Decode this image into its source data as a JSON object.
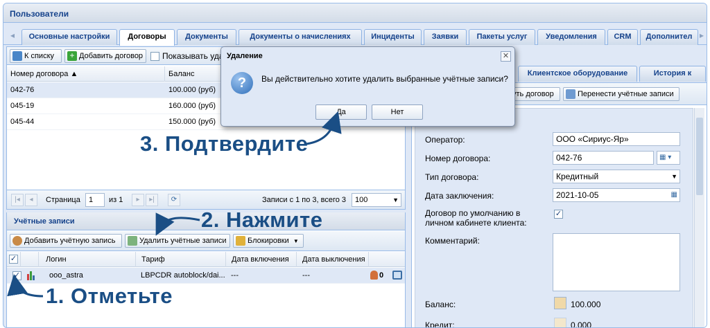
{
  "window": {
    "title": "Пользователи"
  },
  "tabs": [
    {
      "label": "Основные настройки",
      "active": false
    },
    {
      "label": "Договоры",
      "active": true
    },
    {
      "label": "Документы",
      "active": false
    },
    {
      "label": "Документы о начислениях",
      "active": false
    },
    {
      "label": "Инциденты",
      "active": false
    },
    {
      "label": "Заявки",
      "active": false
    },
    {
      "label": "Пакеты услуг",
      "active": false
    },
    {
      "label": "Уведомления",
      "active": false
    },
    {
      "label": "CRM",
      "active": false
    },
    {
      "label": "Дополнител",
      "active": false
    }
  ],
  "contracts": {
    "toolbar": {
      "back": "К списку",
      "add": "Добавить договор",
      "show": "Показывать уда"
    },
    "columns": [
      "Номер договора ▲",
      "Баланс"
    ],
    "rows": [
      {
        "number": "042-76",
        "balance": "100.000 (руб)",
        "selected": true
      },
      {
        "number": "045-19",
        "balance": "160.000 (руб)",
        "selected": false
      },
      {
        "number": "045-44",
        "balance": "150.000 (руб)",
        "selected": false
      }
    ],
    "pager": {
      "page_label": "Страница",
      "page": "1",
      "of": "из 1",
      "summary": "Записи с 1 по 3, всего 3",
      "per_page": "100"
    }
  },
  "accounts": {
    "title": "Учётные записи",
    "toolbar": {
      "add": "Добавить учётную запись",
      "delete": "Удалить учётные записи",
      "locks": "Блокировки"
    },
    "columns": [
      "Логин",
      "Тариф",
      "Дата включения",
      "Дата выключения"
    ],
    "rows": [
      {
        "login": "ooo_astra",
        "tariff": "LBPCDR autoblock/dai...",
        "date_on": "---",
        "date_off": "---",
        "checked": true,
        "status": "0"
      }
    ]
  },
  "right": {
    "tabs": [
      "Клиентское оборудование",
      "История к"
    ],
    "toolbar": {
      "close": "уть договор",
      "move": "Перенести учётные записи"
    },
    "fields": {
      "operator_label": "Оператор:",
      "operator": "ООО «Сириус-Яр»",
      "number_label": "Номер договора:",
      "number": "042-76",
      "type_label": "Тип договора:",
      "type": "Кредитный",
      "date_label": "Дата заключения:",
      "date": "2021-10-05",
      "default_label": "Договор по умолчанию в личном кабинете клиента:",
      "comment_label": "Комментарий:",
      "balance_label": "Баланс:",
      "balance": "100.000",
      "credit_label": "Кредит:",
      "credit": "0.000"
    }
  },
  "dialog": {
    "title": "Удаление",
    "message": "Вы действительно хотите удалить выбранные учётные записи?",
    "yes": "Да",
    "no": "Нет"
  },
  "annotations": {
    "step1": "1. Отметьте",
    "step2": "2. Нажмите",
    "step3": "3. Подтвердите"
  },
  "colors": {
    "accent": "#15428b",
    "annotation": "#1a4e85",
    "panel": "#dfe8f6"
  }
}
